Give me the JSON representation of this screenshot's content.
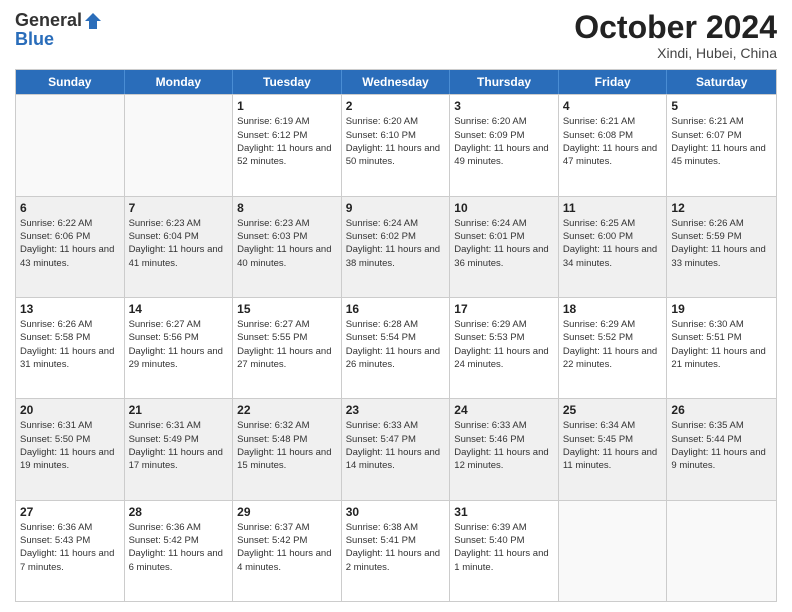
{
  "header": {
    "logo_general": "General",
    "logo_blue": "Blue",
    "month_title": "October 2024",
    "location": "Xindi, Hubei, China"
  },
  "weekdays": [
    "Sunday",
    "Monday",
    "Tuesday",
    "Wednesday",
    "Thursday",
    "Friday",
    "Saturday"
  ],
  "weeks": [
    [
      {
        "day": "",
        "sunrise": "",
        "sunset": "",
        "daylight": "",
        "empty": true
      },
      {
        "day": "",
        "sunrise": "",
        "sunset": "",
        "daylight": "",
        "empty": true
      },
      {
        "day": "1",
        "sunrise": "Sunrise: 6:19 AM",
        "sunset": "Sunset: 6:12 PM",
        "daylight": "Daylight: 11 hours and 52 minutes.",
        "empty": false
      },
      {
        "day": "2",
        "sunrise": "Sunrise: 6:20 AM",
        "sunset": "Sunset: 6:10 PM",
        "daylight": "Daylight: 11 hours and 50 minutes.",
        "empty": false
      },
      {
        "day": "3",
        "sunrise": "Sunrise: 6:20 AM",
        "sunset": "Sunset: 6:09 PM",
        "daylight": "Daylight: 11 hours and 49 minutes.",
        "empty": false
      },
      {
        "day": "4",
        "sunrise": "Sunrise: 6:21 AM",
        "sunset": "Sunset: 6:08 PM",
        "daylight": "Daylight: 11 hours and 47 minutes.",
        "empty": false
      },
      {
        "day": "5",
        "sunrise": "Sunrise: 6:21 AM",
        "sunset": "Sunset: 6:07 PM",
        "daylight": "Daylight: 11 hours and 45 minutes.",
        "empty": false
      }
    ],
    [
      {
        "day": "6",
        "sunrise": "Sunrise: 6:22 AM",
        "sunset": "Sunset: 6:06 PM",
        "daylight": "Daylight: 11 hours and 43 minutes.",
        "empty": false
      },
      {
        "day": "7",
        "sunrise": "Sunrise: 6:23 AM",
        "sunset": "Sunset: 6:04 PM",
        "daylight": "Daylight: 11 hours and 41 minutes.",
        "empty": false
      },
      {
        "day": "8",
        "sunrise": "Sunrise: 6:23 AM",
        "sunset": "Sunset: 6:03 PM",
        "daylight": "Daylight: 11 hours and 40 minutes.",
        "empty": false
      },
      {
        "day": "9",
        "sunrise": "Sunrise: 6:24 AM",
        "sunset": "Sunset: 6:02 PM",
        "daylight": "Daylight: 11 hours and 38 minutes.",
        "empty": false
      },
      {
        "day": "10",
        "sunrise": "Sunrise: 6:24 AM",
        "sunset": "Sunset: 6:01 PM",
        "daylight": "Daylight: 11 hours and 36 minutes.",
        "empty": false
      },
      {
        "day": "11",
        "sunrise": "Sunrise: 6:25 AM",
        "sunset": "Sunset: 6:00 PM",
        "daylight": "Daylight: 11 hours and 34 minutes.",
        "empty": false
      },
      {
        "day": "12",
        "sunrise": "Sunrise: 6:26 AM",
        "sunset": "Sunset: 5:59 PM",
        "daylight": "Daylight: 11 hours and 33 minutes.",
        "empty": false
      }
    ],
    [
      {
        "day": "13",
        "sunrise": "Sunrise: 6:26 AM",
        "sunset": "Sunset: 5:58 PM",
        "daylight": "Daylight: 11 hours and 31 minutes.",
        "empty": false
      },
      {
        "day": "14",
        "sunrise": "Sunrise: 6:27 AM",
        "sunset": "Sunset: 5:56 PM",
        "daylight": "Daylight: 11 hours and 29 minutes.",
        "empty": false
      },
      {
        "day": "15",
        "sunrise": "Sunrise: 6:27 AM",
        "sunset": "Sunset: 5:55 PM",
        "daylight": "Daylight: 11 hours and 27 minutes.",
        "empty": false
      },
      {
        "day": "16",
        "sunrise": "Sunrise: 6:28 AM",
        "sunset": "Sunset: 5:54 PM",
        "daylight": "Daylight: 11 hours and 26 minutes.",
        "empty": false
      },
      {
        "day": "17",
        "sunrise": "Sunrise: 6:29 AM",
        "sunset": "Sunset: 5:53 PM",
        "daylight": "Daylight: 11 hours and 24 minutes.",
        "empty": false
      },
      {
        "day": "18",
        "sunrise": "Sunrise: 6:29 AM",
        "sunset": "Sunset: 5:52 PM",
        "daylight": "Daylight: 11 hours and 22 minutes.",
        "empty": false
      },
      {
        "day": "19",
        "sunrise": "Sunrise: 6:30 AM",
        "sunset": "Sunset: 5:51 PM",
        "daylight": "Daylight: 11 hours and 21 minutes.",
        "empty": false
      }
    ],
    [
      {
        "day": "20",
        "sunrise": "Sunrise: 6:31 AM",
        "sunset": "Sunset: 5:50 PM",
        "daylight": "Daylight: 11 hours and 19 minutes.",
        "empty": false
      },
      {
        "day": "21",
        "sunrise": "Sunrise: 6:31 AM",
        "sunset": "Sunset: 5:49 PM",
        "daylight": "Daylight: 11 hours and 17 minutes.",
        "empty": false
      },
      {
        "day": "22",
        "sunrise": "Sunrise: 6:32 AM",
        "sunset": "Sunset: 5:48 PM",
        "daylight": "Daylight: 11 hours and 15 minutes.",
        "empty": false
      },
      {
        "day": "23",
        "sunrise": "Sunrise: 6:33 AM",
        "sunset": "Sunset: 5:47 PM",
        "daylight": "Daylight: 11 hours and 14 minutes.",
        "empty": false
      },
      {
        "day": "24",
        "sunrise": "Sunrise: 6:33 AM",
        "sunset": "Sunset: 5:46 PM",
        "daylight": "Daylight: 11 hours and 12 minutes.",
        "empty": false
      },
      {
        "day": "25",
        "sunrise": "Sunrise: 6:34 AM",
        "sunset": "Sunset: 5:45 PM",
        "daylight": "Daylight: 11 hours and 11 minutes.",
        "empty": false
      },
      {
        "day": "26",
        "sunrise": "Sunrise: 6:35 AM",
        "sunset": "Sunset: 5:44 PM",
        "daylight": "Daylight: 11 hours and 9 minutes.",
        "empty": false
      }
    ],
    [
      {
        "day": "27",
        "sunrise": "Sunrise: 6:36 AM",
        "sunset": "Sunset: 5:43 PM",
        "daylight": "Daylight: 11 hours and 7 minutes.",
        "empty": false
      },
      {
        "day": "28",
        "sunrise": "Sunrise: 6:36 AM",
        "sunset": "Sunset: 5:42 PM",
        "daylight": "Daylight: 11 hours and 6 minutes.",
        "empty": false
      },
      {
        "day": "29",
        "sunrise": "Sunrise: 6:37 AM",
        "sunset": "Sunset: 5:42 PM",
        "daylight": "Daylight: 11 hours and 4 minutes.",
        "empty": false
      },
      {
        "day": "30",
        "sunrise": "Sunrise: 6:38 AM",
        "sunset": "Sunset: 5:41 PM",
        "daylight": "Daylight: 11 hours and 2 minutes.",
        "empty": false
      },
      {
        "day": "31",
        "sunrise": "Sunrise: 6:39 AM",
        "sunset": "Sunset: 5:40 PM",
        "daylight": "Daylight: 11 hours and 1 minute.",
        "empty": false
      },
      {
        "day": "",
        "sunrise": "",
        "sunset": "",
        "daylight": "",
        "empty": true
      },
      {
        "day": "",
        "sunrise": "",
        "sunset": "",
        "daylight": "",
        "empty": true
      }
    ]
  ]
}
